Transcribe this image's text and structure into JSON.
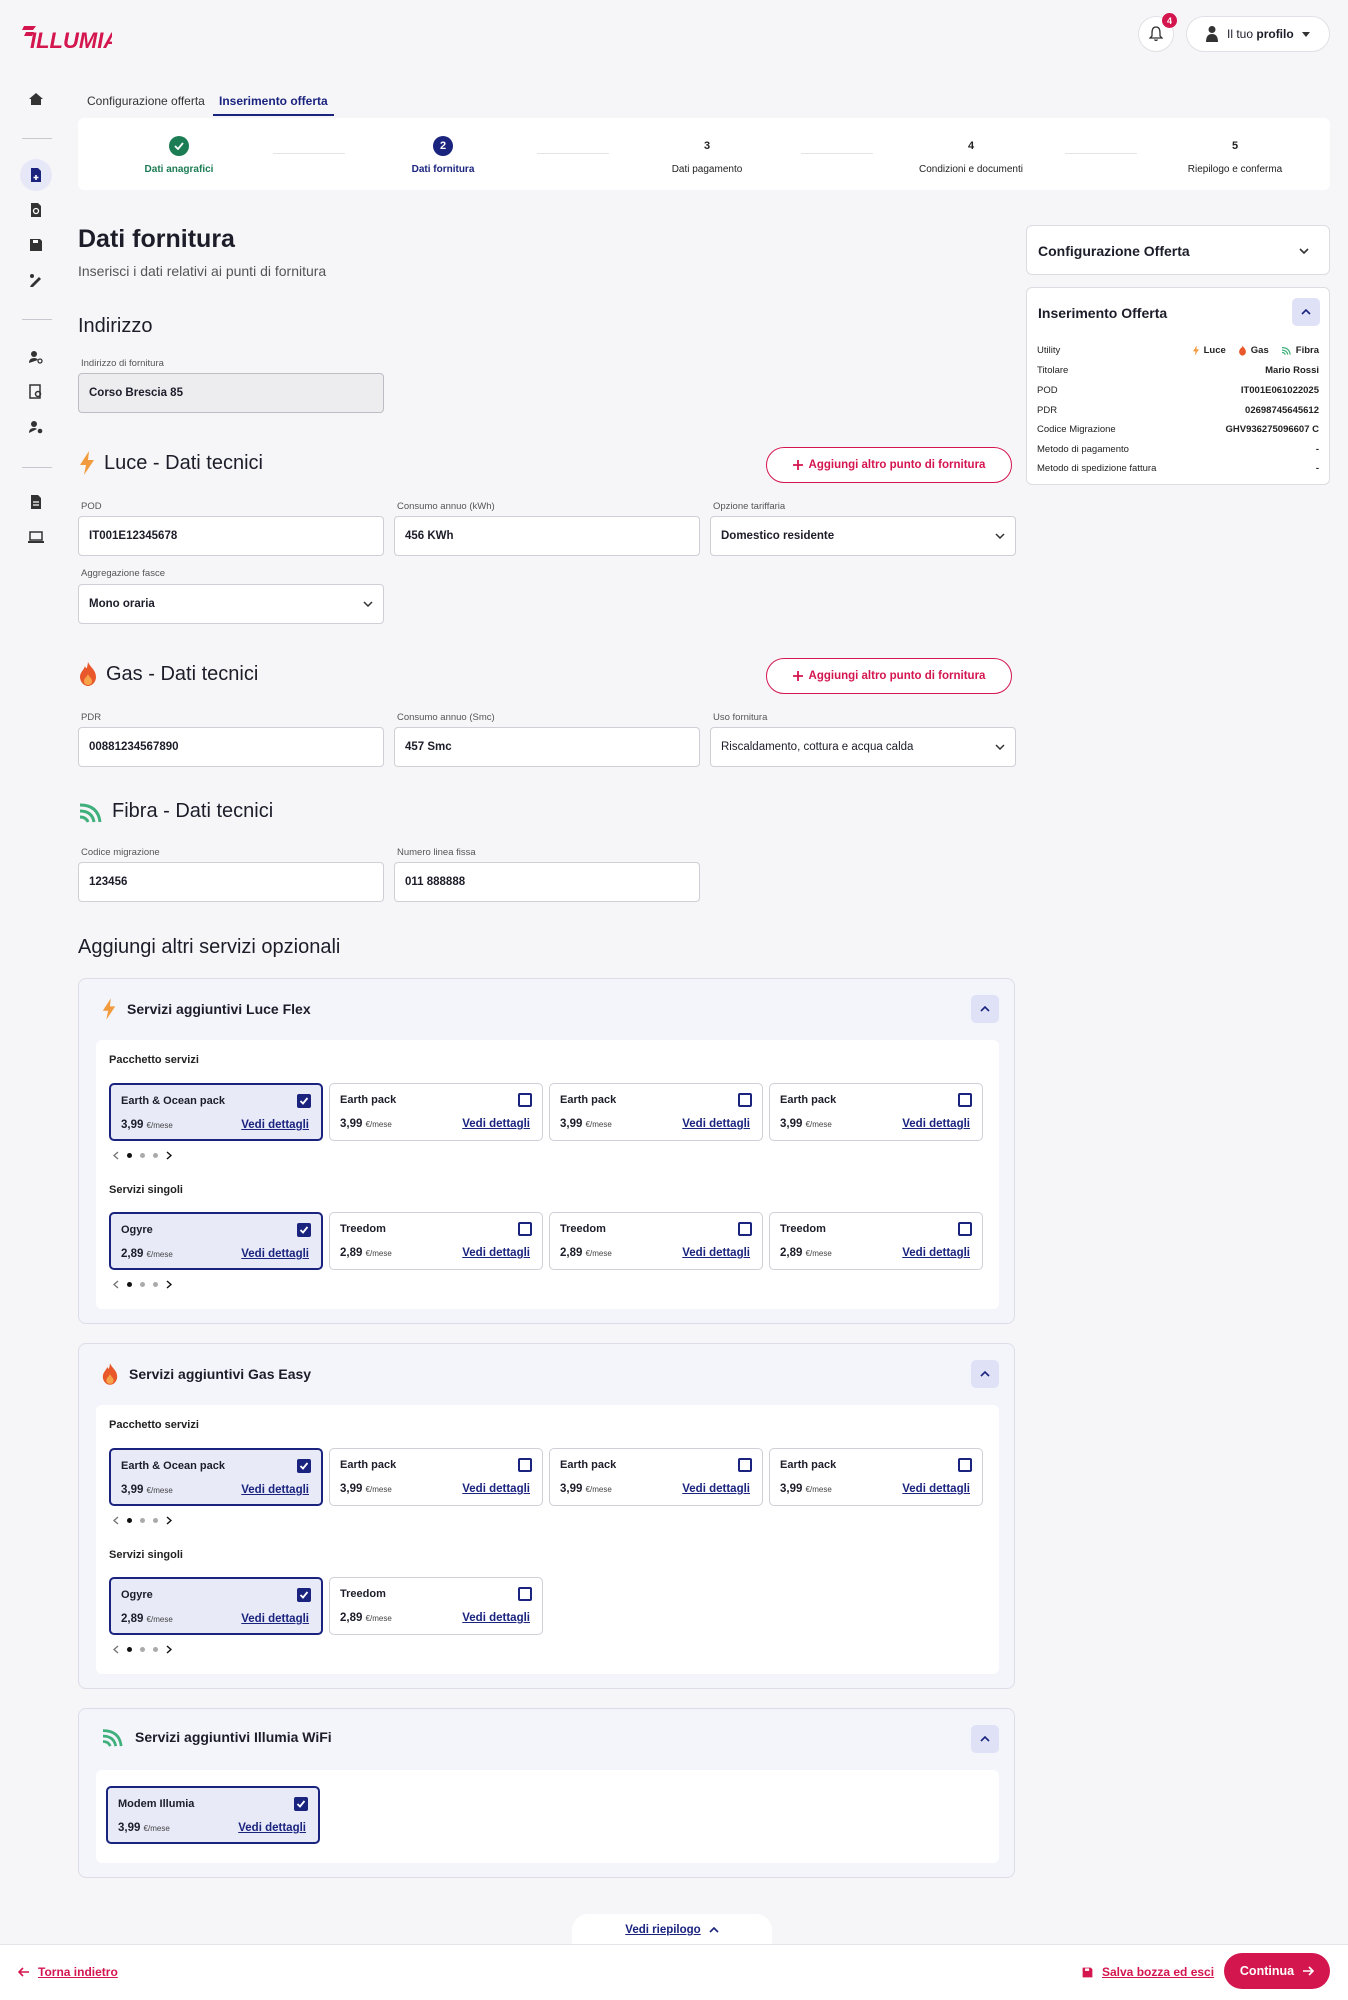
{
  "brand": {
    "logo_text": "ILLUMIA",
    "accent": "#d4164f",
    "primary": "#1a237e",
    "success": "#1c7c54"
  },
  "header": {
    "notifications_count": "4",
    "profile_prefix": "Il tuo",
    "profile_bold": "profilo"
  },
  "tabs": [
    {
      "label": "Configurazione offerta"
    },
    {
      "label": "Inserimento offerta"
    }
  ],
  "stepper": [
    {
      "num": "",
      "label": "Dati anagrafici",
      "state": "done"
    },
    {
      "num": "2",
      "label": "Dati fornitura",
      "state": "current"
    },
    {
      "num": "3",
      "label": "Dati pagamento",
      "state": "todo"
    },
    {
      "num": "4",
      "label": "Condizioni e documenti",
      "state": "todo"
    },
    {
      "num": "5",
      "label": "Riepilogo e conferma",
      "state": "todo"
    }
  ],
  "page": {
    "title": "Dati fornitura",
    "subtitle": "Inserisci i dati relativi ai punti di fornitura"
  },
  "address": {
    "title": "Indirizzo",
    "label": "Indirizzo di fornitura",
    "value": "Corso Brescia 85"
  },
  "add_point_label": "Aggiungi altro punto di fornitura",
  "luce": {
    "title": "Luce - Dati tecnici",
    "pod_label": "POD",
    "pod_value": "IT001E12345678",
    "consumo_label": "Consumo annuo (kWh)",
    "consumo_value": "456 KWh",
    "tariffa_label": "Opzione tariffaria",
    "tariffa_value": "Domestico residente",
    "fasce_label": "Aggregazione fasce",
    "fasce_value": "Mono oraria"
  },
  "gas": {
    "title": "Gas - Dati tecnici",
    "pdr_label": "PDR",
    "pdr_value": "00881234567890",
    "consumo_label": "Consumo annuo (Smc)",
    "consumo_value": "457 Smc",
    "uso_label": "Uso fornitura",
    "uso_value": "Riscaldamento, cottura e acqua calda"
  },
  "fibra": {
    "title": "Fibra - Dati tecnici",
    "codice_label": "Codice migrazione",
    "codice_value": "123456",
    "linea_label": "Numero linea fissa",
    "linea_value": "011 888888"
  },
  "optional_title": "Aggiungi altri servizi opzionali",
  "common": {
    "per_month": "€/mese",
    "details": "Vedi dettagli",
    "pack_label": "Pacchetto servizi",
    "single_label": "Servizi singoli"
  },
  "luce_services": {
    "title": "Servizi aggiuntivi Luce Flex",
    "packs": [
      {
        "name": "Earth & Ocean pack",
        "price": "3,99",
        "selected": true
      },
      {
        "name": "Earth pack",
        "price": "3,99",
        "selected": false
      },
      {
        "name": "Earth pack",
        "price": "3,99",
        "selected": false
      },
      {
        "name": "Earth pack",
        "price": "3,99",
        "selected": false
      }
    ],
    "singles": [
      {
        "name": "Ogyre",
        "price": "2,89",
        "selected": true
      },
      {
        "name": "Treedom",
        "price": "2,89",
        "selected": false
      },
      {
        "name": "Treedom",
        "price": "2,89",
        "selected": false
      },
      {
        "name": "Treedom",
        "price": "2,89",
        "selected": false
      }
    ]
  },
  "gas_services": {
    "title": "Servizi aggiuntivi Gas Easy",
    "packs": [
      {
        "name": "Earth & Ocean pack",
        "price": "3,99",
        "selected": true
      },
      {
        "name": "Earth pack",
        "price": "3,99",
        "selected": false
      },
      {
        "name": "Earth pack",
        "price": "3,99",
        "selected": false
      },
      {
        "name": "Earth pack",
        "price": "3,99",
        "selected": false
      }
    ],
    "singles": [
      {
        "name": "Ogyre",
        "price": "2,89",
        "selected": true
      },
      {
        "name": "Treedom",
        "price": "2,89",
        "selected": false
      }
    ]
  },
  "wifi_services": {
    "title": "Servizi aggiuntivi Illumia WiFi",
    "items": [
      {
        "name": "Modem Illumia",
        "price": "3,99",
        "selected": true
      }
    ]
  },
  "side": {
    "config_title": "Configurazione Offerta",
    "insert_title": "Inserimento Offerta",
    "utility_label": "Utility",
    "utilities": [
      "Luce",
      "Gas",
      "Fibra"
    ],
    "rows": [
      {
        "k": "Titolare",
        "v": "Mario Rossi"
      },
      {
        "k": "POD",
        "v": "IT001E061022025"
      },
      {
        "k": "PDR",
        "v": "02698745645612"
      },
      {
        "k": "Codice Migrazione",
        "v": "GHV936275096607 C"
      },
      {
        "k": "Metodo di pagamento",
        "v": "-"
      },
      {
        "k": "Metodo di spedizione fattura",
        "v": "-"
      }
    ]
  },
  "footer": {
    "back": "Torna indietro",
    "summary": "Vedi riepilogo",
    "save": "Salva bozza ed esci",
    "continue": "Continua"
  }
}
